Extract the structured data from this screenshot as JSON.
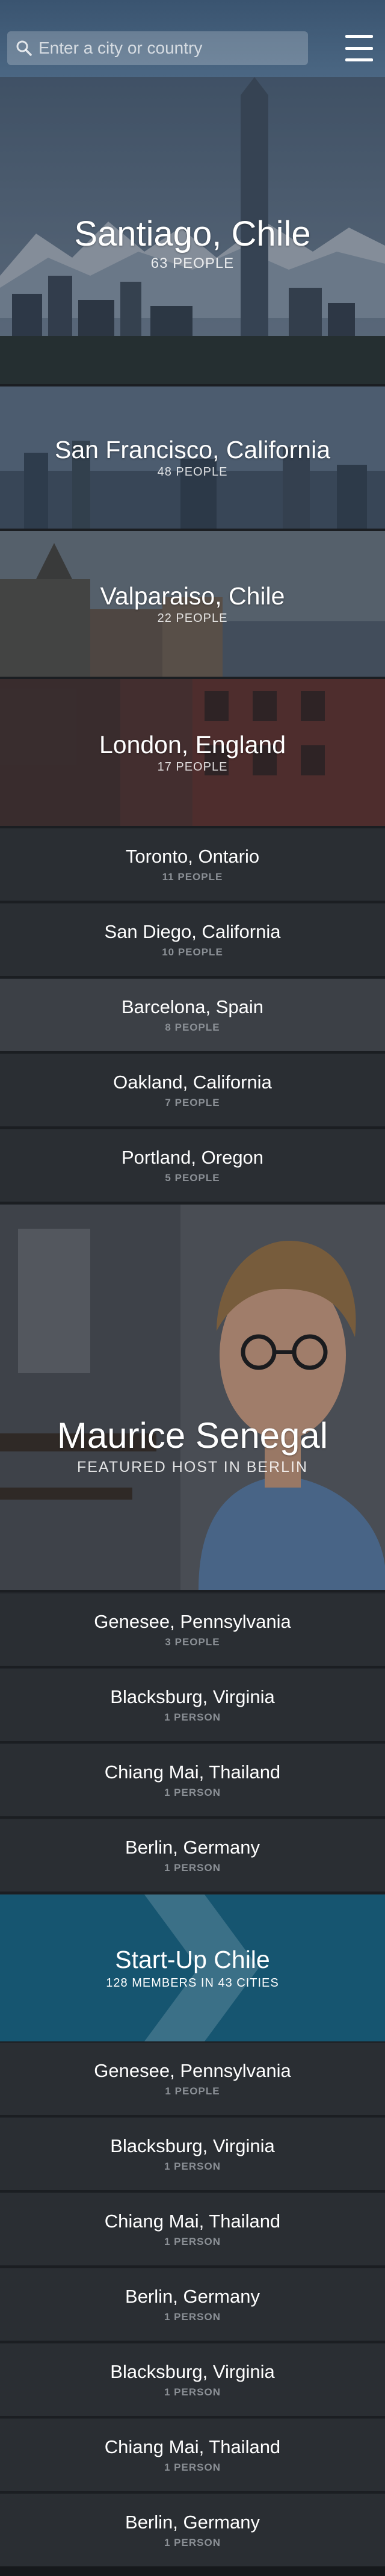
{
  "search": {
    "placeholder": "Enter a city or country"
  },
  "hero": {
    "title": "Santiago, Chile",
    "count": "63 PEOPLE"
  },
  "photo_cities": [
    {
      "title": "San Francisco, California",
      "count": "48 PEOPLE"
    },
    {
      "title": "Valparaiso, Chile",
      "count": "22 PEOPLE"
    },
    {
      "title": "London, England",
      "count": "17 PEOPLE"
    }
  ],
  "cities_a": [
    {
      "title": "Toronto, Ontario",
      "count": "11 PEOPLE"
    },
    {
      "title": "San Diego, California",
      "count": "10 PEOPLE"
    },
    {
      "title": "Barcelona, Spain",
      "count": "8 PEOPLE"
    },
    {
      "title": "Oakland, California",
      "count": "7 PEOPLE"
    },
    {
      "title": "Portland, Oregon",
      "count": "5 PEOPLE"
    }
  ],
  "featured_host": {
    "name": "Maurice Senegal",
    "caption": "FEATURED HOST IN BERLIN"
  },
  "cities_b": [
    {
      "title": "Genesee, Pennsylvania",
      "count": "3 PEOPLE"
    },
    {
      "title": "Blacksburg, Virginia",
      "count": "1 PERSON"
    },
    {
      "title": "Chiang Mai, Thailand",
      "count": "1 PERSON"
    },
    {
      "title": "Berlin, Germany",
      "count": "1 PERSON"
    }
  ],
  "startup": {
    "title": "Start-Up Chile",
    "caption": "128 MEMBERS IN 43 CITIES"
  },
  "cities_c": [
    {
      "title": "Genesee, Pennsylvania",
      "count": "1 PEOPLE"
    },
    {
      "title": "Blacksburg, Virginia",
      "count": "1 PERSON"
    },
    {
      "title": "Chiang Mai, Thailand",
      "count": "1 PERSON"
    },
    {
      "title": "Berlin, Germany",
      "count": "1 PERSON"
    },
    {
      "title": "Blacksburg, Virginia",
      "count": "1 PERSON"
    },
    {
      "title": "Chiang Mai, Thailand",
      "count": "1 PERSON"
    },
    {
      "title": "Berlin, Germany",
      "count": "1 PERSON"
    }
  ],
  "icons": {
    "search": "search-icon",
    "menu": "hamburger-menu-icon"
  },
  "colors": {
    "header": "#3a5470",
    "row": "#2a2e33",
    "row_highlight": "#3c4046",
    "startup": "#165570"
  }
}
